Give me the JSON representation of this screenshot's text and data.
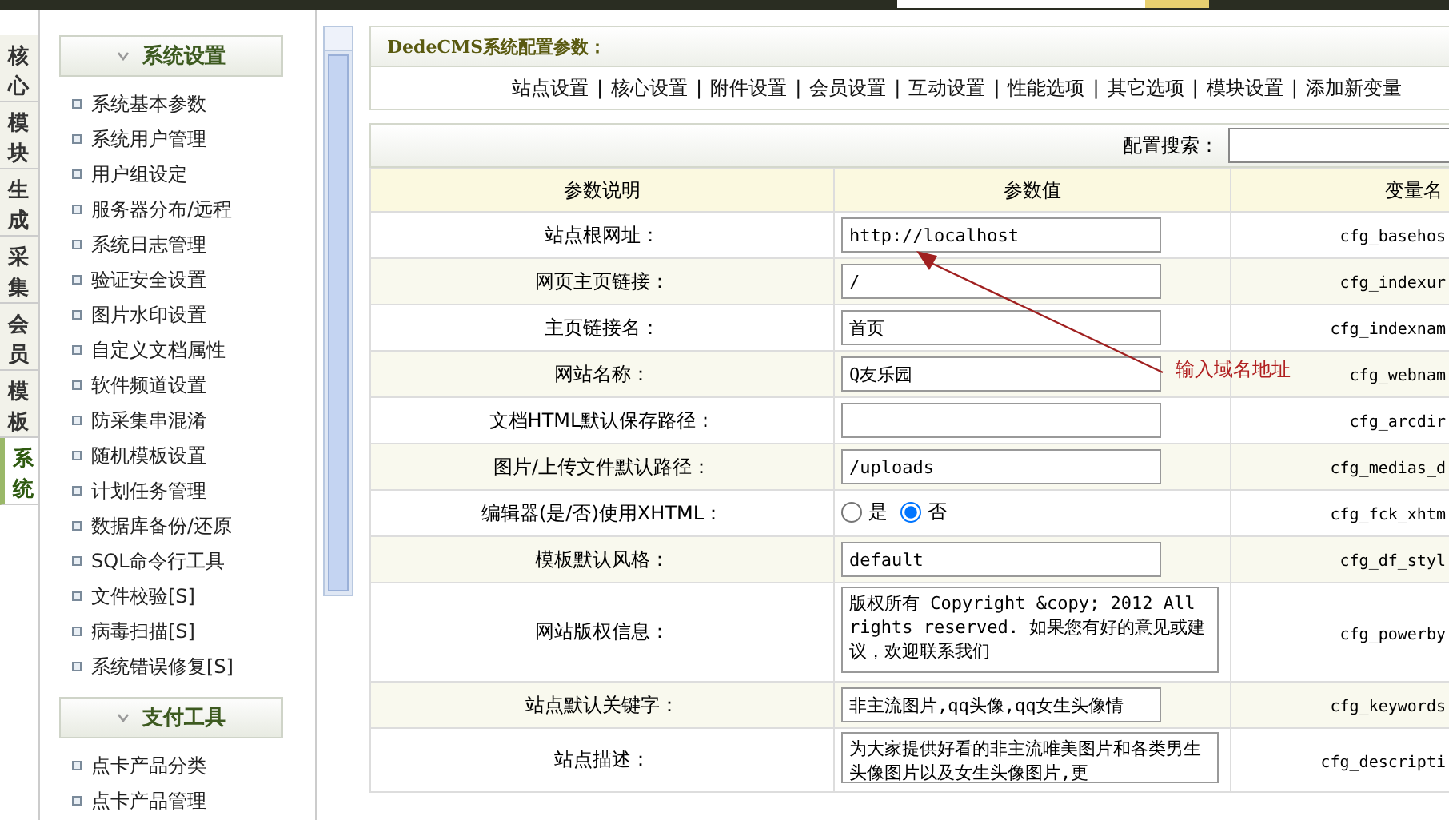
{
  "side_tabs": [
    {
      "label": "核心",
      "selected": false
    },
    {
      "label": "模块",
      "selected": false
    },
    {
      "label": "生成",
      "selected": false
    },
    {
      "label": "采集",
      "selected": false
    },
    {
      "label": "会员",
      "selected": false
    },
    {
      "label": "模板",
      "selected": false
    },
    {
      "label": "系统",
      "selected": true
    }
  ],
  "sidebar": {
    "groups": [
      {
        "title": "系统设置",
        "expanded": true,
        "items": [
          "系统基本参数",
          "系统用户管理",
          "用户组设定",
          "服务器分布/远程",
          "系统日志管理",
          "验证安全设置",
          "图片水印设置",
          "自定义文档属性",
          "软件频道设置",
          "防采集串混淆",
          "随机模板设置",
          "计划任务管理",
          "数据库备份/还原",
          "SQL命令行工具",
          "文件校验[S]",
          "病毒扫描[S]",
          "系统错误修复[S]"
        ]
      },
      {
        "title": "支付工具",
        "expanded": true,
        "items": [
          "点卡产品分类",
          "点卡产品管理"
        ]
      }
    ]
  },
  "panel_title": "DedeCMS系统配置参数：",
  "config_tab_separator": "|",
  "config_tabs": [
    "站点设置",
    "核心设置",
    "附件设置",
    "会员设置",
    "互动设置",
    "性能选项",
    "其它选项",
    "模块设置",
    "添加新变量"
  ],
  "search": {
    "label": "配置搜索："
  },
  "table": {
    "columns": [
      "参数说明",
      "参数值",
      "变量名"
    ],
    "rows": [
      {
        "kind": "text",
        "label": "站点根网址：",
        "value": "http://localhost",
        "variable": "cfg_basehos"
      },
      {
        "kind": "text",
        "label": "网页主页链接：",
        "value": "/",
        "variable": "cfg_indexur"
      },
      {
        "kind": "text",
        "label": "主页链接名：",
        "value": "首页",
        "variable": "cfg_indexnam"
      },
      {
        "kind": "text",
        "label": "网站名称：",
        "value": "Q友乐园",
        "variable": "cfg_webnam"
      },
      {
        "kind": "text",
        "label": "文档HTML默认保存路径：",
        "variable": "cfg_arcdir"
      },
      {
        "kind": "text",
        "label": "图片/上传文件默认路径：",
        "value": "/uploads",
        "variable": "cfg_medias_d"
      },
      {
        "kind": "radio",
        "label": "编辑器(是/否)使用XHTML：",
        "options": [
          {
            "label": "是",
            "selected": false
          },
          {
            "label": "否",
            "selected": true
          }
        ],
        "variable": "cfg_fck_xhtm"
      },
      {
        "kind": "text",
        "label": "模板默认风格：",
        "value": "default",
        "variable": "cfg_df_styl"
      },
      {
        "kind": "textarea",
        "label": "网站版权信息：",
        "value": "版权所有 Copyright &copy; 2012 All rights reserved. 如果您有好的意见或建议，欢迎联系我们",
        "variable": "cfg_powerby"
      },
      {
        "kind": "text",
        "label": "站点默认关键字：",
        "value": "非主流图片,qq头像,qq女生头像情",
        "variable": "cfg_keywords"
      },
      {
        "kind": "textarea",
        "label": "站点描述：",
        "value": "为大家提供好看的非主流唯美图片和各类男生头像图片以及女生头像图片,更",
        "variable": "cfg_descripti"
      }
    ]
  },
  "annotation": {
    "text": "输入域名地址"
  }
}
